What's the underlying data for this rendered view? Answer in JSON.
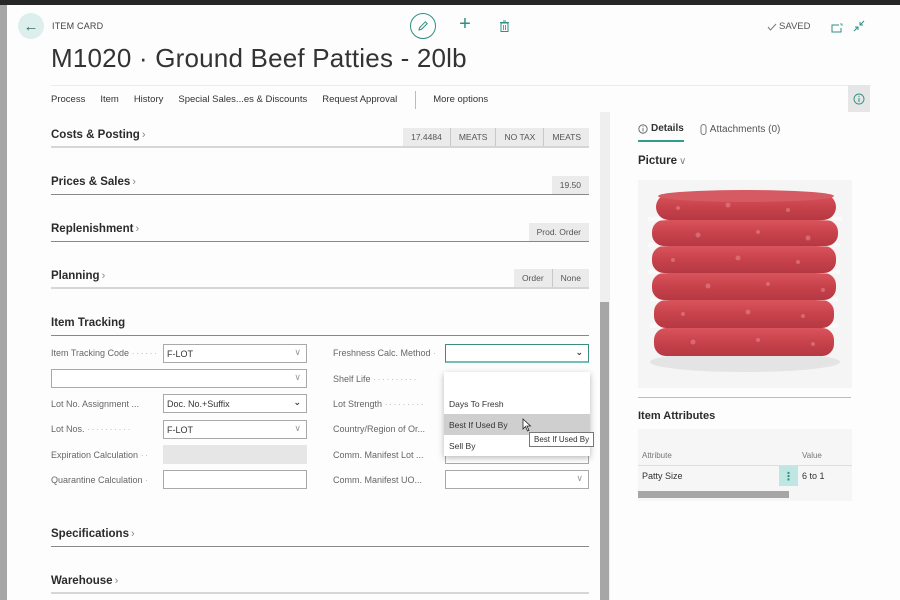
{
  "header": {
    "breadcrumb": "ITEM CARD",
    "title": "M1020 · Ground Beef Patties - 20lb",
    "saved_label": "SAVED",
    "icons": {
      "back": "arrow-left-icon",
      "edit": "pencil-icon",
      "add": "plus-icon",
      "delete": "trash-icon",
      "saved": "check-icon",
      "open_new": "open-in-new-window-icon",
      "collapse": "collapse-icon",
      "info": "info-icon"
    }
  },
  "actions": {
    "items": [
      "Process",
      "Item",
      "History",
      "Special Sales...es & Discounts",
      "Request Approval"
    ],
    "more": "More options"
  },
  "sections": [
    {
      "title": "Costs & Posting",
      "pills": [
        "17.4484",
        "MEATS",
        "NO TAX",
        "MEATS"
      ]
    },
    {
      "title": "Prices & Sales",
      "pills": [
        "19.50"
      ]
    },
    {
      "title": "Replenishment",
      "pills": [
        "Prod. Order"
      ]
    },
    {
      "title": "Planning",
      "pills": [
        "Order",
        "None"
      ]
    },
    {
      "title": "Item Tracking",
      "pills": []
    },
    {
      "title": "Specifications",
      "pills": []
    },
    {
      "title": "Warehouse",
      "pills": []
    }
  ],
  "item_tracking": {
    "left": [
      {
        "label": "Item Tracking Code",
        "value": "F-LOT"
      },
      {
        "label": "",
        "value": ""
      },
      {
        "label": "Lot No. Assignment ...",
        "value": "Doc. No.+Suffix"
      },
      {
        "label": "Lot Nos.",
        "value": "F-LOT"
      },
      {
        "label": "Expiration Calculation",
        "value": ""
      },
      {
        "label": "Quarantine Calculation",
        "value": ""
      }
    ],
    "right": [
      {
        "label": "Freshness Calc. Method",
        "value": ""
      },
      {
        "label": "Shelf Life",
        "value": ""
      },
      {
        "label": "Lot Strength",
        "value": ""
      },
      {
        "label": "Country/Region of Or...",
        "value": ""
      },
      {
        "label": "Comm. Manifest Lot ...",
        "value": ""
      },
      {
        "label": "Comm. Manifest UO...",
        "value": ""
      }
    ],
    "dropdown": {
      "options": [
        "",
        "Days To Fresh",
        "Best If Used By",
        "Sell By"
      ],
      "highlighted": "Best If Used By",
      "tooltip": "Best If Used By"
    }
  },
  "factbox": {
    "tabs": [
      {
        "label": "Details",
        "icon": "info-icon",
        "active": true
      },
      {
        "label": "Attachments (0)",
        "icon": "paperclip-icon",
        "active": false
      }
    ],
    "picture_title": "Picture",
    "picture_alt": "Stack of ground beef patties",
    "attributes_title": "Item Attributes",
    "attributes_columns": [
      "Attribute",
      "Value"
    ],
    "attributes_rows": [
      {
        "attribute": "Patty Size",
        "value": "6 to 1"
      }
    ]
  }
}
